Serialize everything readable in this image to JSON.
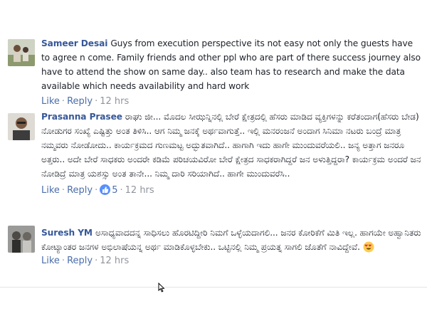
{
  "comments": [
    {
      "author": "Sameer Desai",
      "text": "Guys from execution perspective its not easy not only the guests have to agree n come. Family friends and other ppl who are part of there success journey also have to attend the show on same day.. also team has to research and make the data available which needs availability and hard work",
      "like_label": "Like",
      "reply_label": "Reply",
      "time": "12 hrs"
    },
    {
      "author": "Prasanna Prasee",
      "text": "ರಾಘು ಜೀ... ಮೊದಲ ಸೀಝನ್ನಿನಲ್ಲಿ ಬೇರೆ ಕ್ಷೇತ್ರದಲ್ಲಿ ಹೆಸರು ಮಾಡಿದ ವ್ಯಕ್ತಿಗಳನ್ನು ಕರೆತಂದಾಗ(ಹೆಸರು ಬೇಡ) ನೋಡುಗರ ಸಂಖ್ಯೆ ಎಷ್ಟಿತ್ತು ಅಂತ ತಿಳಿಸಿ.. ಆಗ ನಿಮ್ಮ ಜನಕ್ಕೆ ಅರ್ಥವಾಗುತ್ತೆ.. ಇಲ್ಲಿ ಮನರಂಜನೆ ಅಂದಾಗ ಸಿನಿಮಾ ನಟರು ಬಂದ್ರೆ ಮಾತ್ರ ನಮ್ಮವರು ನೋಡೋದು.. ಕಾರ್ಯಕ್ರಮದ ಗುಣಮಟ್ಟ ಅದ್ಭುತವಾಗಿದೆ.. ಹಾಗಾಗಿ ಇದು ಹಾಗೇ ಮುಂದುವರೆಯಲಿ.. ಜನ್ಯ ಅತ್ತಾಗ ಜನರೂ ಅತ್ತರು.. ಅದೇ ಬೇರೆ ಸಾಧಕರು ಅಂದರೇ ಕಡಿಮೆ ಪರಿಚಯವಿರೋ ಬೇರೆ ಕ್ಷೇತ್ರದ ಸಾಧಕರಾಗಿದ್ದರೆ ಜನ ಅಳುತ್ತಿದ್ದರಾ? ಕಾರ್ಯಕ್ರಮ ಅಂದರೆ ಜನ ನೋಡಿದ್ರೆ ಮಾತ್ರ ಯಶಸ್ಸು ಅಂತ ತಾನೇ... ನಿಮ್ಮ ದಾರಿ ಸರಿಯಾಗಿದೆ.. ಹಾಗೇ ಮುಂದುವರೆಸಿ..",
      "like_label": "Like",
      "reply_label": "Reply",
      "reactions": "5",
      "time": "12 hrs"
    },
    {
      "author": "Suresh YM",
      "text": "ಅಸಾಧ್ಯವಾದದನ್ನ ಸಾಧಿಸಲು ಹೊರಟಿದ್ದೀರಿ ನಿಮಗೆ ಒಳ್ಳೆಯದಾಗಲಿ... ಜನರ ಕೋರಿಕೆಗೆ ಮಿತಿ ಇಲ್ಲ. ಹಾಗಯೇ ಅಹ್ವಾನಿತರು ಕೋಟ್ಯಾಂತರ ಜನಗಳ ಅಭಿಲಾಷೆಯನ್ನ ಅರ್ಥ ಮಾಡಿಕೊಳ್ಳಬೇಕು.. ಒಟ್ಟಿನಲ್ಲಿ ನಿಮ್ಮ ಪ್ರಯತ್ನ ಸಾಗಲಿ ಜೊತೆಗೆ ನಾವಿದ್ದೇವೆ.",
      "like_label": "Like",
      "reply_label": "Reply",
      "time": "12 hrs"
    }
  ],
  "icons": {
    "like_reaction": "thumbs-up-icon",
    "emoji": "heart-eyes-emoji-icon",
    "cursor": "mouse-cursor-icon"
  },
  "colors": {
    "author": "#365899",
    "link": "#4b6eaa",
    "meta": "#90949c",
    "text": "#1d2129",
    "like_badge": "#5890ff"
  }
}
